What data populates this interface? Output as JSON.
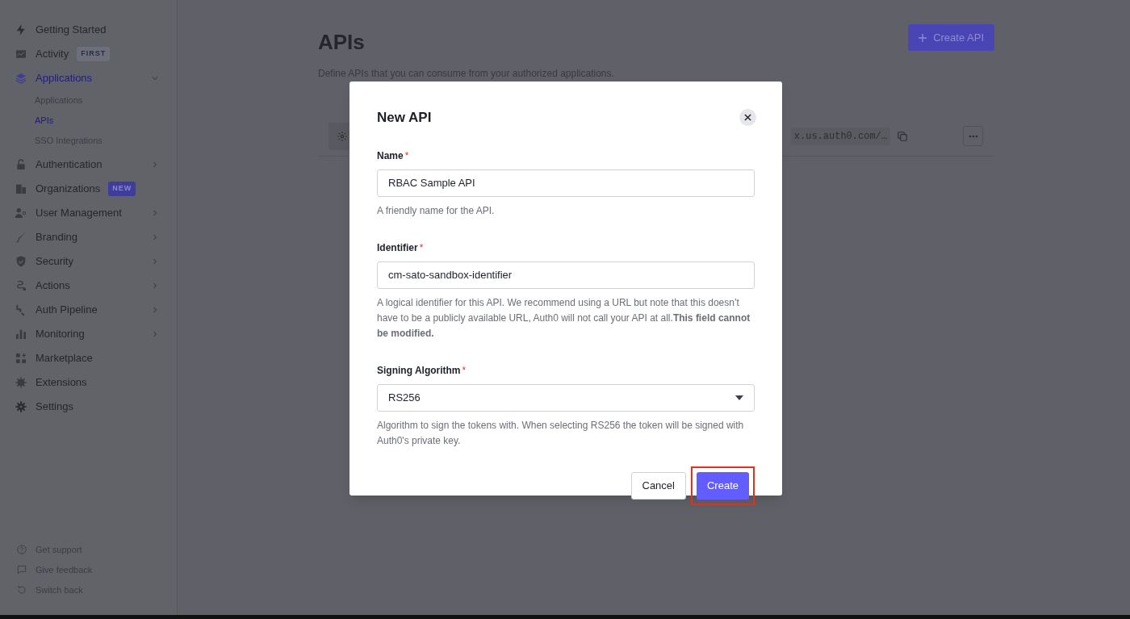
{
  "sidebar": {
    "items": [
      {
        "label": "Getting Started",
        "selected": false
      },
      {
        "label": "Activity",
        "selected": false,
        "badge": {
          "label": "FIRST",
          "kind": "neutral"
        }
      },
      {
        "label": "Applications",
        "selected": true,
        "expanded": true,
        "children": [
          {
            "label": "Applications",
            "selected": false
          },
          {
            "label": "APIs",
            "selected": true
          },
          {
            "label": "SSO Integrations",
            "selected": false
          }
        ]
      },
      {
        "label": "Authentication",
        "selected": false,
        "expanded": false
      },
      {
        "label": "Organizations",
        "selected": false,
        "badge": {
          "label": "NEW",
          "kind": "accent"
        }
      },
      {
        "label": "User Management",
        "selected": false,
        "expanded": false
      },
      {
        "label": "Branding",
        "selected": false,
        "expanded": false
      },
      {
        "label": "Security",
        "selected": false,
        "expanded": false
      },
      {
        "label": "Actions",
        "selected": false,
        "expanded": false
      },
      {
        "label": "Auth Pipeline",
        "selected": false,
        "expanded": false
      },
      {
        "label": "Monitoring",
        "selected": false,
        "expanded": false
      },
      {
        "label": "Marketplace",
        "selected": false
      },
      {
        "label": "Extensions",
        "selected": false
      },
      {
        "label": "Settings",
        "selected": false
      }
    ],
    "footer": [
      {
        "label": "Get support"
      },
      {
        "label": "Give feedback"
      },
      {
        "label": "Switch back"
      }
    ]
  },
  "page": {
    "title": "APIs",
    "description": "Define APIs that you can consume from your authorized applications.",
    "create_button": "Create API",
    "row": {
      "identifier": "x.us.auth0.com/…"
    }
  },
  "dialog": {
    "title": "New API",
    "fields": [
      {
        "kind": "text",
        "label": "Name",
        "required_mark": "*",
        "value": "RBAC Sample API",
        "help": "A friendly name for the API."
      },
      {
        "kind": "text",
        "label": "Identifier",
        "required_mark": "*",
        "value": "cm-sato-sandbox-identifier",
        "help": "A logical identifier for this API. We recommend using a URL but note that this doesn’t have to be a publicly available URL, Auth0 will not call your API at all.**This field cannot be modified.**"
      },
      {
        "kind": "select",
        "label": "Signing Algorithm",
        "required_mark": "*",
        "value": "RS256",
        "help": "Algorithm to sign the tokens with. When selecting RS256 the token will be signed with Auth0's private key."
      }
    ],
    "buttons": [
      {
        "kind": "secondary",
        "label": "Cancel",
        "highlighted": false
      },
      {
        "kind": "primary",
        "label": "Create",
        "highlighted": true
      }
    ]
  }
}
